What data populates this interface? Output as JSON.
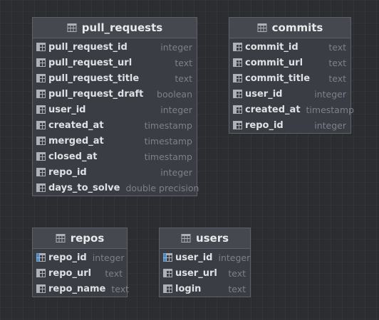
{
  "theme": {
    "background": "#2b2d30",
    "table_fill": "#3a3d43",
    "header_fill": "#45484f",
    "key_accent": "#3d8bd4"
  },
  "tables": [
    {
      "id": "pull-requests",
      "title": "pull_requests",
      "icon": "table-icon",
      "columns": [
        {
          "name": "pull_request_id",
          "type": "integer",
          "icon": "column-icon"
        },
        {
          "name": "pull_request_url",
          "type": "text",
          "icon": "column-icon"
        },
        {
          "name": "pull_request_title",
          "type": "text",
          "icon": "column-icon"
        },
        {
          "name": "pull_request_draft",
          "type": "boolean",
          "icon": "column-icon"
        },
        {
          "name": "user_id",
          "type": "integer",
          "icon": "column-icon"
        },
        {
          "name": "created_at",
          "type": "timestamp",
          "icon": "column-icon"
        },
        {
          "name": "merged_at",
          "type": "timestamp",
          "icon": "column-icon"
        },
        {
          "name": "closed_at",
          "type": "timestamp",
          "icon": "column-icon"
        },
        {
          "name": "repo_id",
          "type": "integer",
          "icon": "column-icon"
        },
        {
          "name": "days_to_solve",
          "type": "double precision",
          "icon": "column-icon"
        }
      ]
    },
    {
      "id": "commits",
      "title": "commits",
      "icon": "table-icon",
      "columns": [
        {
          "name": "commit_id",
          "type": "text",
          "icon": "column-icon"
        },
        {
          "name": "commit_url",
          "type": "text",
          "icon": "column-icon"
        },
        {
          "name": "commit_title",
          "type": "text",
          "icon": "column-icon"
        },
        {
          "name": "user_id",
          "type": "integer",
          "icon": "column-icon"
        },
        {
          "name": "created_at",
          "type": "timestamp",
          "icon": "column-icon"
        },
        {
          "name": "repo_id",
          "type": "integer",
          "icon": "column-icon"
        }
      ]
    },
    {
      "id": "repos",
      "title": "repos",
      "icon": "table-icon",
      "columns": [
        {
          "name": "repo_id",
          "type": "integer",
          "icon": "key-column-icon"
        },
        {
          "name": "repo_url",
          "type": "text",
          "icon": "column-icon"
        },
        {
          "name": "repo_name",
          "type": "text",
          "icon": "column-icon"
        }
      ]
    },
    {
      "id": "users",
      "title": "users",
      "icon": "table-icon",
      "columns": [
        {
          "name": "user_id",
          "type": "integer",
          "icon": "key-column-icon"
        },
        {
          "name": "user_url",
          "type": "text",
          "icon": "column-icon"
        },
        {
          "name": "login",
          "type": "text",
          "icon": "column-icon"
        }
      ]
    }
  ]
}
